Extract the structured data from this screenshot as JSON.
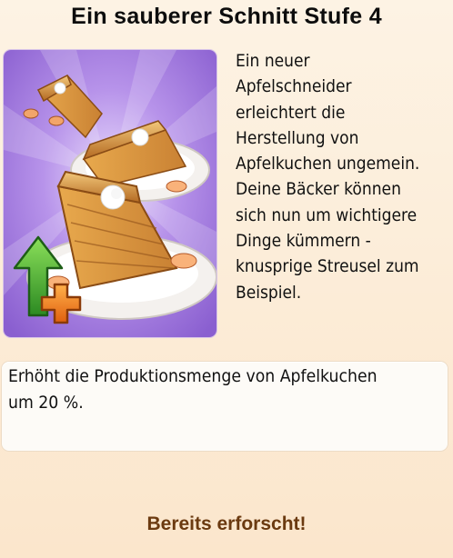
{
  "title": "Ein sauberer Schnitt Stufe 4",
  "icon": {
    "name": "apple-pie-upgrade-icon"
  },
  "description": "Ein neuer Apfelschneider\nerleichtert die\nHerstellung von\nApfelkuchen ungemein.\nDeine Bäcker können\nsich nun um wichtigere\nDinge kümmern -\nknusprige Streusel zum\nBeispiel.",
  "effect": "Erhöht die Produktionsmenge von Apfelkuchen um 20 %.",
  "status": "Bereits erforscht!",
  "colors": {
    "background": "#fbe6cc",
    "icon_background": "#a87fe0",
    "status_text": "#6b3a10",
    "arrow_green": "#3faa2e",
    "plus_orange": "#f07a1a"
  }
}
